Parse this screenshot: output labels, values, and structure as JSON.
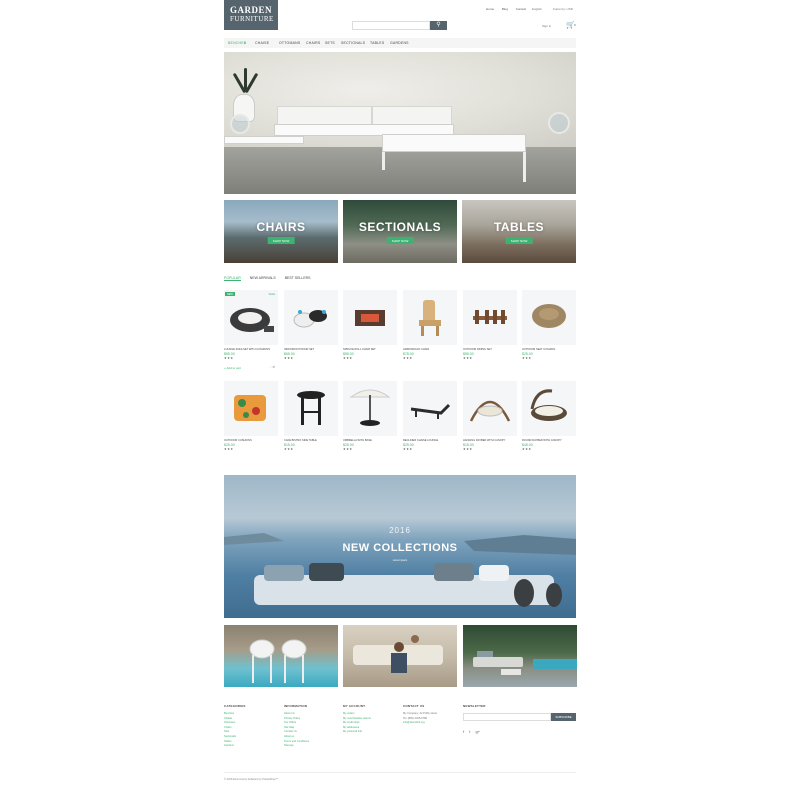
{
  "logo": {
    "line1": "GARDEN",
    "line2": "FURNITURE"
  },
  "top_links": [
    "Home",
    "Blog",
    "Contact"
  ],
  "top_right": [
    "English",
    "Currency: USD"
  ],
  "search": {
    "placeholder": "",
    "button_icon": "search-icon"
  },
  "account": {
    "sign_in": "Sign in",
    "cart_count": "0"
  },
  "nav": {
    "items": [
      "BENCHES",
      "CHAISE",
      "OTTOMANS",
      "CHAIRS",
      "SETS",
      "SECTIONALS",
      "TABLES",
      "GARDENS"
    ],
    "active": "BENCHES"
  },
  "categories": [
    {
      "title": "CHAIRS",
      "button": "SHOP NOW"
    },
    {
      "title": "SECTIONALS",
      "button": "SHOP NOW"
    },
    {
      "title": "TABLES",
      "button": "SHOP NOW"
    }
  ],
  "tabs": [
    "POPULAR",
    "NEW ARRIVALS",
    "BEST SELLERS"
  ],
  "badges": {
    "new": "NEW",
    "sale": "SALE"
  },
  "add_to_cart": "+ Add to cart",
  "products": [
    {
      "name": "LOUNGE SOFA SET WITH CUSHIONS",
      "price": "$55.00",
      "stars": "★★★"
    },
    {
      "name": "INDOOR/OUTDOOR SET",
      "price": "$65.00",
      "stars": "★★★"
    },
    {
      "name": "SPRUCE ROLL CHAIR SET",
      "price": "$55.00",
      "stars": "★★★"
    },
    {
      "name": "ADIRONDACK CHAIR",
      "price": "$78.00",
      "stars": "★★★"
    },
    {
      "name": "OUTDOOR DINING SET",
      "price": "$55.00",
      "stars": "★★★"
    },
    {
      "name": "OUTDOOR SEAT CUSHION",
      "price": "$25.00",
      "stars": "★★★"
    },
    {
      "name": "OUTDOOR CUSHIONS",
      "price": "$25.00",
      "stars": "★★★"
    },
    {
      "name": "CAFE BISTRO SIDE TABLE",
      "price": "$15.00",
      "stars": "★★★"
    },
    {
      "name": "UMBRELLA WITH BASE",
      "price": "$25.00",
      "stars": "★★★"
    },
    {
      "name": "RECLINER CHAISE LOUNGE",
      "price": "$25.00",
      "stars": "★★★"
    },
    {
      "name": "HANGING DAYBED WITH CANOPY",
      "price": "$15.00",
      "stars": "★★★"
    },
    {
      "name": "ROUND DAYBED WITH CANOPY",
      "price": "$45.00",
      "stars": "★★★"
    }
  ],
  "banner": {
    "year": "2016",
    "title": "NEW COLLECTIONS",
    "subtitle": "Lorem ipsum"
  },
  "footer": {
    "columns": [
      {
        "heading": "CATEGORIES",
        "links": [
          "Benches",
          "Chaise",
          "Ottomans",
          "Chairs",
          "Sets",
          "Sectionals",
          "Tables",
          "Gardens"
        ]
      },
      {
        "heading": "INFORMATION",
        "links": [
          "About Us",
          "Privacy Policy",
          "Our Offers",
          "Site Map",
          "Contact Us",
          "About us",
          "Terms and Conditions",
          "Sitemap"
        ]
      },
      {
        "heading": "MY ACCOUNT",
        "links": [
          "My orders",
          "My merchandise returns",
          "My credit slips",
          "My addresses",
          "My personal info"
        ]
      },
      {
        "heading": "CONTACT US",
        "lines": [
          "My Company, 42 Puffin street",
          "Tel: (800) 2345-6789",
          "info@demolink.org"
        ]
      },
      {
        "heading": "NEWSLETTER",
        "button": "SUBSCRIBE"
      }
    ],
    "social": [
      "f",
      "t",
      "g+"
    ],
    "copyright": "© 2016 Ecommerce Software by PrestaShop™"
  },
  "colors": {
    "accent": "#3cb371",
    "dark": "#56656d"
  }
}
